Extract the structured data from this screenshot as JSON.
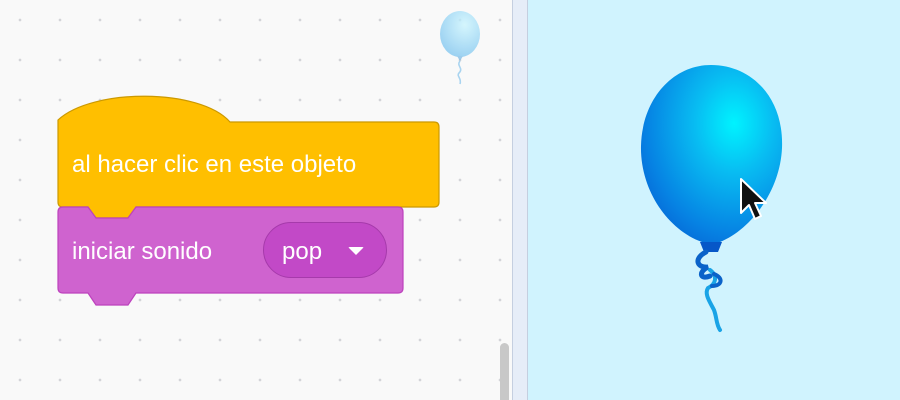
{
  "workspace": {
    "hat_block": {
      "label": "al hacer clic en este objeto",
      "color": "#ffbf00"
    },
    "sound_block": {
      "label": "iniciar sonido",
      "color": "#cf63cf",
      "dropdown": {
        "selected": "pop"
      }
    },
    "sprite_thumbnail_icon": "balloon-icon"
  },
  "stage": {
    "background_color": "#d0f3fe",
    "sprite_icon": "balloon-icon",
    "balloon_color": "#0a8fe8",
    "pointer_icon": "mouse-pointer-icon"
  }
}
